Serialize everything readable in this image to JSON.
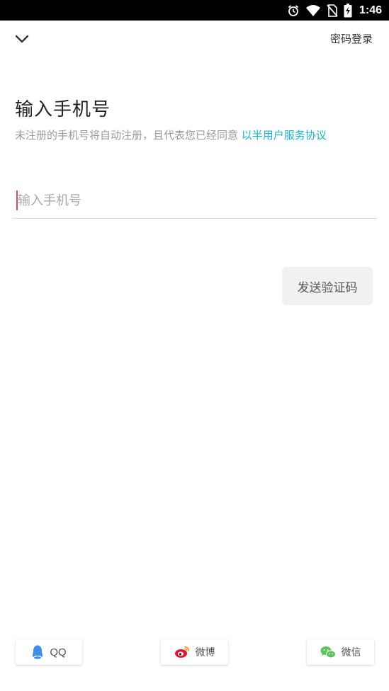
{
  "status_bar": {
    "time": "1:46",
    "icons": [
      "alarm-icon",
      "wifi-icon",
      "no-sim-icon",
      "battery-charging-icon"
    ]
  },
  "header": {
    "back_icon": "chevron-down-icon",
    "password_login_label": "密码登录"
  },
  "main": {
    "title": "输入手机号",
    "subtitle_text": "未注册的手机号将自动注册，且代表您已经同意 ",
    "agreement_link": "以半用户服务协议",
    "phone_input": {
      "value": "",
      "placeholder": "输入手机号"
    },
    "send_code_label": "发送验证码"
  },
  "social_login": [
    {
      "name": "qq",
      "icon": "qq-penguin-icon",
      "label": "QQ",
      "color": "#3d8ee8"
    },
    {
      "name": "weibo",
      "icon": "weibo-icon",
      "label": "微博",
      "color": "#e6162d"
    },
    {
      "name": "wechat",
      "icon": "wechat-icon",
      "label": "微信",
      "color": "#5cc45a"
    }
  ],
  "colors": {
    "link": "#14b8cc",
    "caret": "#d44a78",
    "button_bg": "#f1f1f1"
  }
}
